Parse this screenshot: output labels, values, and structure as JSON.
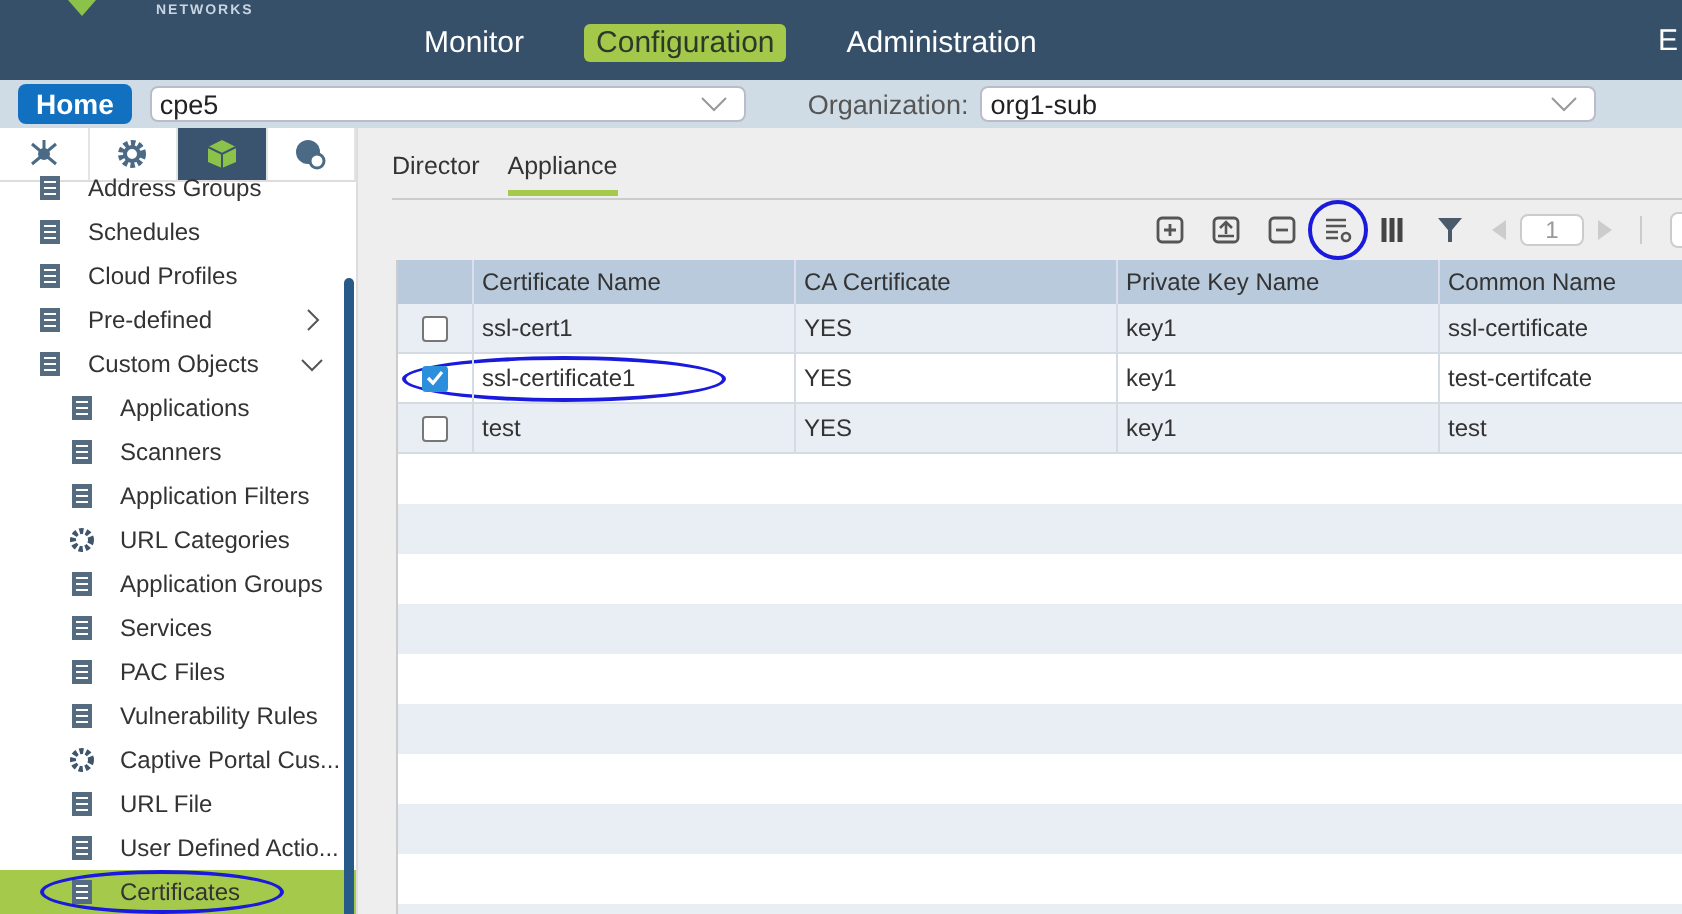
{
  "header": {
    "logo_text": "NETWORKS",
    "nav": [
      {
        "label": "Monitor",
        "selected": false
      },
      {
        "label": "Configuration",
        "selected": true
      },
      {
        "label": "Administration",
        "selected": false
      }
    ],
    "cut_text": "E"
  },
  "context_bar": {
    "home": "Home",
    "appliance": "cpe5",
    "org_label": "Organization:",
    "organization": "org1-sub"
  },
  "sidebar": {
    "icon_tabs": [
      {
        "selected": false
      },
      {
        "selected": false
      },
      {
        "selected": true
      },
      {
        "selected": false
      }
    ],
    "items": [
      {
        "label": "Address Groups",
        "kind": "item",
        "selected": false,
        "annotated": false
      },
      {
        "label": "Schedules",
        "kind": "item",
        "selected": false,
        "annotated": false
      },
      {
        "label": "Cloud Profiles",
        "kind": "item",
        "selected": false,
        "annotated": false
      },
      {
        "label": "Pre-defined",
        "kind": "group",
        "expanded": false,
        "selected": false,
        "annotated": false
      },
      {
        "label": "Custom Objects",
        "kind": "group",
        "expanded": true,
        "selected": false,
        "annotated": false,
        "children": [
          {
            "label": "Applications",
            "selected": false,
            "annotated": false
          },
          {
            "label": "Scanners",
            "selected": false,
            "annotated": false
          },
          {
            "label": "Application Filters",
            "selected": false,
            "annotated": false
          },
          {
            "label": "URL Categories",
            "selected": false,
            "annotated": false
          },
          {
            "label": "Application Groups",
            "selected": false,
            "annotated": false
          },
          {
            "label": "Services",
            "selected": false,
            "annotated": false
          },
          {
            "label": "PAC Files",
            "selected": false,
            "annotated": false
          },
          {
            "label": "Vulnerability Rules",
            "selected": false,
            "annotated": false
          },
          {
            "label": "Captive Portal Cus...",
            "selected": false,
            "annotated": false
          },
          {
            "label": "URL File",
            "selected": false,
            "annotated": false
          },
          {
            "label": "User Defined Actio...",
            "selected": false,
            "annotated": false
          },
          {
            "label": "Certificates",
            "selected": true,
            "annotated": true
          }
        ]
      }
    ]
  },
  "tabs": [
    {
      "label": "Director",
      "selected": false
    },
    {
      "label": "Appliance",
      "selected": true
    }
  ],
  "toolbar": {
    "buttons": [
      {
        "kind": "add",
        "annotated": false
      },
      {
        "kind": "upload",
        "annotated": false
      },
      {
        "kind": "remove",
        "annotated": false
      },
      {
        "kind": "details",
        "annotated": true
      },
      {
        "kind": "columns",
        "annotated": false
      },
      {
        "kind": "filter",
        "annotated": false
      }
    ],
    "page": "1"
  },
  "table": {
    "columns": [
      "Certificate Name",
      "CA Certificate",
      "Private Key Name",
      "Common Name"
    ],
    "rows": [
      {
        "selected": false,
        "annotated": false,
        "cells": [
          "ssl-cert1",
          "YES",
          "key1",
          "ssl-certificate"
        ]
      },
      {
        "selected": true,
        "annotated": true,
        "cells": [
          "ssl-certificate1",
          "YES",
          "key1",
          "test-certifcate"
        ]
      },
      {
        "selected": false,
        "annotated": false,
        "cells": [
          "test",
          "YES",
          "key1",
          "test"
        ]
      }
    ]
  }
}
